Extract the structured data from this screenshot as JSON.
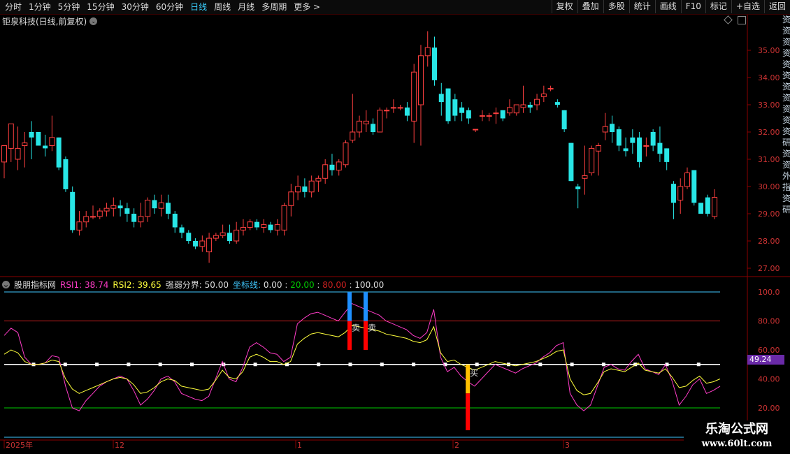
{
  "toolbar": {
    "periods": [
      "分时",
      "1分钟",
      "5分钟",
      "15分钟",
      "30分钟",
      "60分钟",
      "日线",
      "周线",
      "月线",
      "多周期",
      "更多 >"
    ],
    "active_period": "日线",
    "actions": [
      "复权",
      "叠加",
      "多股",
      "统计",
      "画线",
      "F10",
      "标记",
      "+自选",
      "返回"
    ]
  },
  "stock": {
    "title": "钜泉科技(日线,前复权)"
  },
  "indicator": {
    "name": "股朋指标网",
    "rsi1_label": "RSI1:",
    "rsi1_value": "38.74",
    "rsi2_label": "RSI2:",
    "rsi2_value": "39.65",
    "boundary_label": "强弱分界:",
    "boundary_value": "50.00",
    "coord_label": "坐标线:",
    "coord_values": [
      "0.00",
      "20.00",
      "80.00",
      "100.00"
    ],
    "current_value": "49.24",
    "buy_label": "买",
    "sell_label": "卖",
    "colors": {
      "rsi1": "#ff3cc8",
      "rsi2": "#ffff3c",
      "boundary": "#ffffff",
      "line20": "#00cc00",
      "line80": "#cc2020",
      "line100": "#40c8ff",
      "buy": "#ffc000",
      "sell": "#1e90ff",
      "signal_red": "#ff0000"
    }
  },
  "price_axis": [
    "35.00",
    "34.00",
    "33.00",
    "32.00",
    "31.00",
    "30.00",
    "29.00",
    "28.00",
    "27.00"
  ],
  "ind_axis": [
    "100.0",
    "80.00",
    "60.00",
    "40.00",
    "20.00"
  ],
  "date_axis": [
    "2025年",
    "12",
    "1",
    "2",
    "3"
  ],
  "side_text": "资资资资资资资资资资资研资资外指资研",
  "logo": {
    "line1": "乐淘公式网",
    "line2": "www.60lt.com"
  },
  "candles": [
    [
      30.9,
      31.5,
      31.4,
      30.3
    ],
    [
      31.4,
      32.3,
      30.9,
      31.7
    ],
    [
      31.0,
      31.4,
      32.2,
      30.6
    ],
    [
      31.5,
      31.6,
      32.0,
      30.7
    ],
    [
      32.0,
      31.8,
      32.4,
      31.0
    ],
    [
      32.0,
      31.5,
      32.0,
      31.5
    ],
    [
      31.5,
      31.4,
      31.9,
      31.1
    ],
    [
      31.5,
      31.8,
      32.6,
      31.3
    ],
    [
      31.8,
      30.7,
      31.8,
      30.6
    ],
    [
      31.0,
      29.9,
      31.1,
      29.8
    ],
    [
      29.8,
      28.4,
      30.0,
      28.3
    ],
    [
      28.4,
      28.7,
      29.1,
      28.2
    ],
    [
      28.7,
      28.9,
      29.1,
      28.5
    ],
    [
      28.9,
      28.9,
      29.3,
      28.8
    ],
    [
      28.9,
      29.1,
      29.2,
      28.8
    ],
    [
      29.1,
      29.2,
      29.4,
      28.9
    ],
    [
      29.2,
      29.3,
      29.6,
      28.9
    ],
    [
      29.3,
      29.2,
      29.5,
      28.9
    ],
    [
      29.2,
      29.0,
      29.4,
      28.7
    ],
    [
      29.0,
      28.7,
      29.2,
      28.5
    ],
    [
      28.7,
      28.9,
      29.4,
      28.5
    ],
    [
      28.9,
      29.5,
      29.6,
      28.7
    ],
    [
      29.5,
      29.2,
      29.7,
      29.0
    ],
    [
      29.2,
      29.4,
      29.7,
      28.9
    ],
    [
      29.4,
      29.0,
      29.7,
      28.8
    ],
    [
      29.0,
      28.5,
      29.1,
      28.3
    ],
    [
      28.5,
      28.3,
      28.6,
      28.1
    ],
    [
      28.3,
      28.0,
      28.4,
      27.9
    ],
    [
      28.0,
      27.8,
      28.1,
      27.7
    ],
    [
      27.8,
      28.0,
      28.2,
      27.6
    ],
    [
      27.6,
      28.1,
      28.3,
      27.2
    ],
    [
      28.1,
      28.2,
      28.3,
      28.0
    ],
    [
      28.2,
      28.3,
      28.6,
      28.1
    ],
    [
      28.3,
      28.0,
      28.6,
      27.9
    ],
    [
      28.0,
      28.4,
      28.7,
      27.9
    ],
    [
      28.4,
      28.5,
      28.8,
      28.2
    ],
    [
      28.5,
      28.7,
      28.8,
      28.4
    ],
    [
      28.7,
      28.5,
      28.8,
      28.4
    ],
    [
      28.5,
      28.6,
      28.8,
      28.3
    ],
    [
      28.6,
      28.4,
      28.7,
      28.3
    ],
    [
      28.4,
      28.6,
      28.8,
      28.2
    ],
    [
      28.4,
      29.3,
      29.4,
      28.2
    ],
    [
      29.3,
      29.8,
      30.1,
      28.9
    ],
    [
      29.8,
      30.0,
      30.4,
      29.5
    ],
    [
      30.0,
      29.8,
      30.3,
      29.6
    ],
    [
      29.8,
      30.2,
      30.4,
      29.6
    ],
    [
      30.2,
      30.3,
      30.4,
      29.8
    ],
    [
      30.3,
      30.8,
      31.0,
      30.1
    ],
    [
      30.8,
      30.6,
      31.2,
      30.4
    ],
    [
      30.6,
      30.9,
      31.0,
      30.4
    ],
    [
      30.8,
      31.6,
      31.7,
      30.7
    ],
    [
      31.7,
      32.0,
      33.4,
      31.6
    ],
    [
      32.0,
      32.4,
      32.6,
      31.8
    ],
    [
      32.3,
      32.4,
      32.8,
      32.0
    ],
    [
      32.3,
      32.0,
      32.5,
      31.9
    ],
    [
      32.0,
      32.8,
      32.9,
      32.0
    ],
    [
      32.8,
      32.8,
      32.9,
      32.5
    ],
    [
      32.9,
      32.9,
      33.2,
      32.7
    ],
    [
      32.9,
      32.9,
      33.0,
      32.8
    ],
    [
      32.9,
      32.6,
      33.1,
      32.4
    ],
    [
      32.4,
      34.2,
      34.5,
      31.6
    ],
    [
      33.0,
      34.8,
      35.2,
      31.5
    ],
    [
      34.8,
      35.1,
      35.7,
      34.4
    ],
    [
      35.1,
      33.9,
      35.5,
      33.7
    ],
    [
      33.4,
      33.1,
      33.8,
      32.6
    ],
    [
      33.6,
      32.4,
      33.6,
      32.3
    ],
    [
      33.2,
      32.6,
      33.4,
      32.4
    ],
    [
      32.9,
      32.7,
      33.1,
      32.4
    ],
    [
      32.8,
      32.5,
      32.9,
      32.3
    ],
    [
      32.1,
      32.1,
      32.1,
      32.0
    ],
    [
      32.6,
      32.6,
      32.8,
      32.4
    ],
    [
      32.6,
      32.6,
      32.7,
      32.4
    ],
    [
      32.7,
      32.7,
      32.9,
      32.3
    ],
    [
      32.8,
      32.5,
      32.8,
      32.4
    ],
    [
      32.7,
      32.9,
      33.2,
      32.6
    ],
    [
      32.7,
      33.0,
      33.0,
      32.6
    ],
    [
      32.9,
      33.0,
      33.7,
      32.7
    ],
    [
      33.0,
      32.9,
      33.1,
      32.7
    ],
    [
      33.0,
      33.2,
      33.4,
      32.8
    ],
    [
      33.3,
      33.4,
      33.7,
      33.1
    ],
    [
      33.6,
      33.6,
      33.7,
      33.5
    ],
    [
      33.1,
      33.0,
      33.2,
      32.9
    ],
    [
      32.8,
      32.1,
      32.8,
      32.0
    ],
    [
      31.6,
      30.2,
      31.6,
      30.2
    ],
    [
      30.0,
      29.9,
      30.1,
      29.2
    ],
    [
      30.3,
      30.4,
      31.5,
      29.7
    ],
    [
      30.5,
      31.4,
      31.5,
      30.4
    ],
    [
      31.3,
      31.5,
      31.6,
      30.4
    ],
    [
      32.0,
      32.2,
      32.7,
      31.7
    ],
    [
      32.3,
      32.0,
      32.6,
      31.6
    ],
    [
      32.1,
      31.5,
      32.2,
      31.3
    ],
    [
      31.4,
      31.3,
      31.8,
      31.1
    ],
    [
      31.8,
      31.6,
      32.1,
      31.2
    ],
    [
      31.8,
      30.9,
      32.0,
      30.7
    ],
    [
      31.5,
      31.5,
      31.8,
      31.1
    ],
    [
      32.0,
      31.5,
      32.1,
      31.3
    ],
    [
      31.6,
      31.2,
      32.2,
      30.9
    ],
    [
      31.4,
      30.9,
      31.4,
      30.6
    ],
    [
      30.1,
      29.4,
      30.2,
      28.8
    ],
    [
      29.5,
      30.0,
      30.3,
      29.0
    ],
    [
      30.0,
      30.5,
      30.7,
      29.9
    ],
    [
      30.6,
      29.4,
      30.6,
      29.3
    ],
    [
      29.4,
      29.0,
      29.4,
      29.0
    ],
    [
      29.6,
      29.0,
      29.7,
      28.9
    ],
    [
      28.9,
      29.6,
      29.9,
      28.8
    ]
  ],
  "rsi1": [
    70,
    75,
    72,
    55,
    50,
    50,
    51,
    56,
    55,
    35,
    20,
    18,
    25,
    30,
    35,
    38,
    40,
    42,
    40,
    32,
    22,
    26,
    32,
    40,
    42,
    38,
    30,
    28,
    26,
    25,
    28,
    40,
    52,
    40,
    38,
    48,
    62,
    65,
    62,
    58,
    57,
    52,
    55,
    78,
    82,
    85,
    86,
    84,
    82,
    80,
    86,
    92,
    90,
    88,
    86,
    84,
    80,
    78,
    76,
    74,
    70,
    68,
    72,
    88,
    55,
    45,
    48,
    42,
    38,
    35,
    40,
    45,
    50,
    48,
    46,
    44,
    47,
    49,
    51,
    55,
    58,
    63,
    65,
    30,
    22,
    18,
    22,
    35,
    48,
    50,
    47,
    46,
    52,
    57,
    47,
    45,
    43,
    50,
    38,
    22,
    28,
    36,
    40,
    30,
    32,
    35
  ],
  "rsi2": [
    57,
    60,
    58,
    52,
    50,
    50,
    51,
    53,
    52,
    40,
    33,
    30,
    32,
    34,
    36,
    38,
    40,
    41,
    40,
    36,
    30,
    31,
    34,
    38,
    40,
    39,
    35,
    34,
    33,
    32,
    33,
    39,
    46,
    41,
    40,
    45,
    55,
    57,
    55,
    52,
    52,
    50,
    52,
    64,
    68,
    71,
    72,
    71,
    70,
    69,
    72,
    77,
    76,
    75,
    74,
    73,
    71,
    70,
    69,
    68,
    66,
    65,
    67,
    76,
    58,
    52,
    53,
    50,
    48,
    46,
    48,
    50,
    52,
    51,
    50,
    49,
    50,
    51,
    52,
    54,
    56,
    59,
    60,
    40,
    32,
    29,
    30,
    37,
    45,
    47,
    46,
    45,
    48,
    51,
    46,
    45,
    44,
    47,
    41,
    34,
    35,
    39,
    42,
    37,
    38,
    40
  ],
  "buy_index": 68,
  "sell_indices": [
    109,
    114
  ]
}
